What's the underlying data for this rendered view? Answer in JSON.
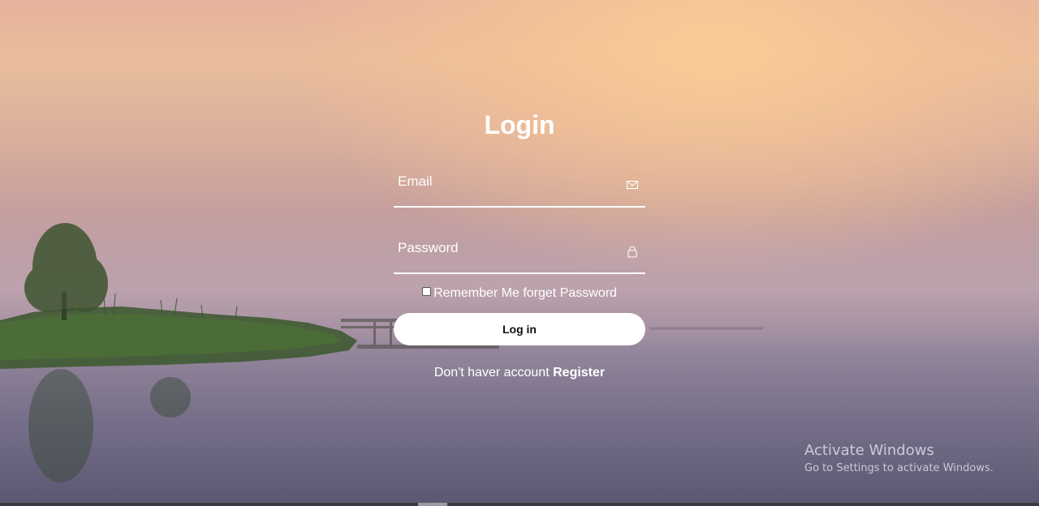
{
  "login": {
    "title": "Login",
    "email_placeholder": "Email",
    "password_placeholder": "Password",
    "remember_label": "Remember Me",
    "forgot_label": "forget Password",
    "login_button": "Log in",
    "no_account_text": "Don't haver account",
    "register_link": "Register"
  },
  "icons": {
    "email": "envelope-icon",
    "password": "lock-icon"
  },
  "watermark": {
    "title": "Activate Windows",
    "subtitle": "Go to Settings to activate Windows."
  },
  "colors": {
    "text": "#ffffff",
    "button_bg": "#ffffff",
    "button_text": "#111111"
  }
}
